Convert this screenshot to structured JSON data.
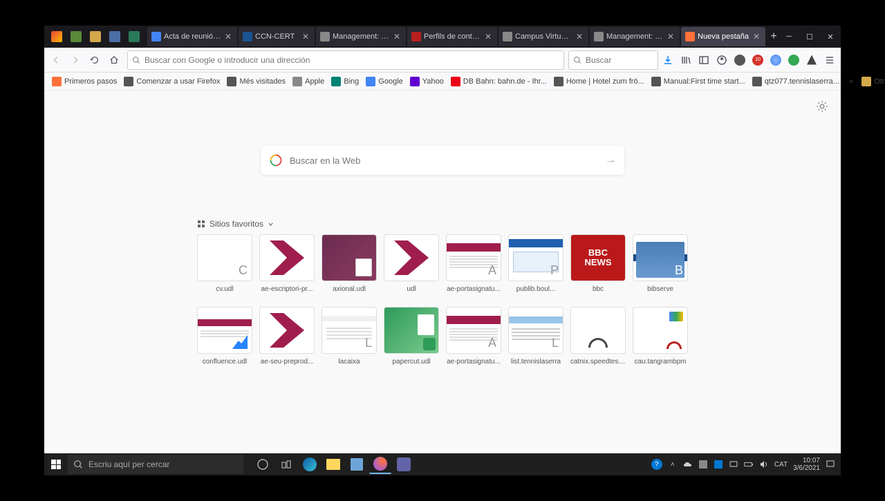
{
  "tabs": [
    {
      "title": "Acta de reunió: U",
      "favicon_bg": "#4285f4"
    },
    {
      "title": "CCN-CERT",
      "favicon_bg": "#1a5490"
    },
    {
      "title": "Management: Tim",
      "favicon_bg": "#888"
    },
    {
      "title": "Perfils de contrac",
      "favicon_bg": "#b82020"
    },
    {
      "title": "Campus Virtual UdL",
      "favicon_bg": "#888"
    },
    {
      "title": "Management: Tim",
      "favicon_bg": "#888"
    },
    {
      "title": "Nueva pestaña",
      "favicon_bg": "#ff7139",
      "active": true
    }
  ],
  "urlbar": {
    "placeholder": "Buscar con Google o introducir una dirección"
  },
  "searchbar": {
    "placeholder": "Buscar"
  },
  "bookmarks": [
    {
      "label": "Primeros pasos",
      "favicon": "#ff7139"
    },
    {
      "label": "Comenzar a usar Firefox",
      "favicon": "#555"
    },
    {
      "label": "Més visitades",
      "favicon": "#555"
    },
    {
      "label": "Apple",
      "favicon": "#888"
    },
    {
      "label": "Bing",
      "favicon": "#008373"
    },
    {
      "label": "Google",
      "favicon": "#4285f4"
    },
    {
      "label": "Yahoo",
      "favicon": "#6001d2"
    },
    {
      "label": "DB Bahn: bahn.de - Ihr...",
      "favicon": "#ec0016"
    },
    {
      "label": "Home | Hotel zum frö...",
      "favicon": "#555"
    },
    {
      "label": "Manual:First time start...",
      "favicon": "#555"
    },
    {
      "label": "qtz077.tennislaserra...",
      "favicon": "#555"
    }
  ],
  "bookmarks_overflow": "»",
  "bookmarks_other": "Otros marcadores",
  "center_search": {
    "placeholder": "Buscar en la Web"
  },
  "fav_section": {
    "title": "Sitios favoritos"
  },
  "favorites_row1": [
    {
      "label": "cv.udl",
      "thumb": "blank",
      "letter": "C"
    },
    {
      "label": "ae-escriptori-pr...",
      "thumb": "k"
    },
    {
      "label": "axional.udl",
      "thumb": "axional"
    },
    {
      "label": "udl",
      "thumb": "k"
    },
    {
      "label": "ae-portasignatu...",
      "thumb": "doc",
      "letter": "A"
    },
    {
      "label": "publib.boul...",
      "thumb": "publib",
      "letter": "P"
    },
    {
      "label": "bbc",
      "thumb": "bbc",
      "text": "BBC\nNEWS"
    },
    {
      "label": "bibserve",
      "thumb": "bibserve",
      "letter": "B"
    }
  ],
  "favorites_row2": [
    {
      "label": "confluence.udl",
      "thumb": "confluence"
    },
    {
      "label": "ae-seu-preprod...",
      "thumb": "k"
    },
    {
      "label": "lacaixa",
      "thumb": "lacaixa",
      "letter": "L"
    },
    {
      "label": "papercut.udl",
      "thumb": "papercut"
    },
    {
      "label": "ae-portasignatu...",
      "thumb": "doc",
      "letter": "A"
    },
    {
      "label": "list.tennislaserra",
      "thumb": "list",
      "letter": "L"
    },
    {
      "label": "catnix.speedtest...",
      "thumb": "speed"
    },
    {
      "label": "cau.tangrambpm",
      "thumb": "cau"
    }
  ],
  "taskbar": {
    "search_placeholder": "Escriu aquí per cercar",
    "lang": "CAT",
    "time": "10:07",
    "date": "3/6/2021"
  }
}
